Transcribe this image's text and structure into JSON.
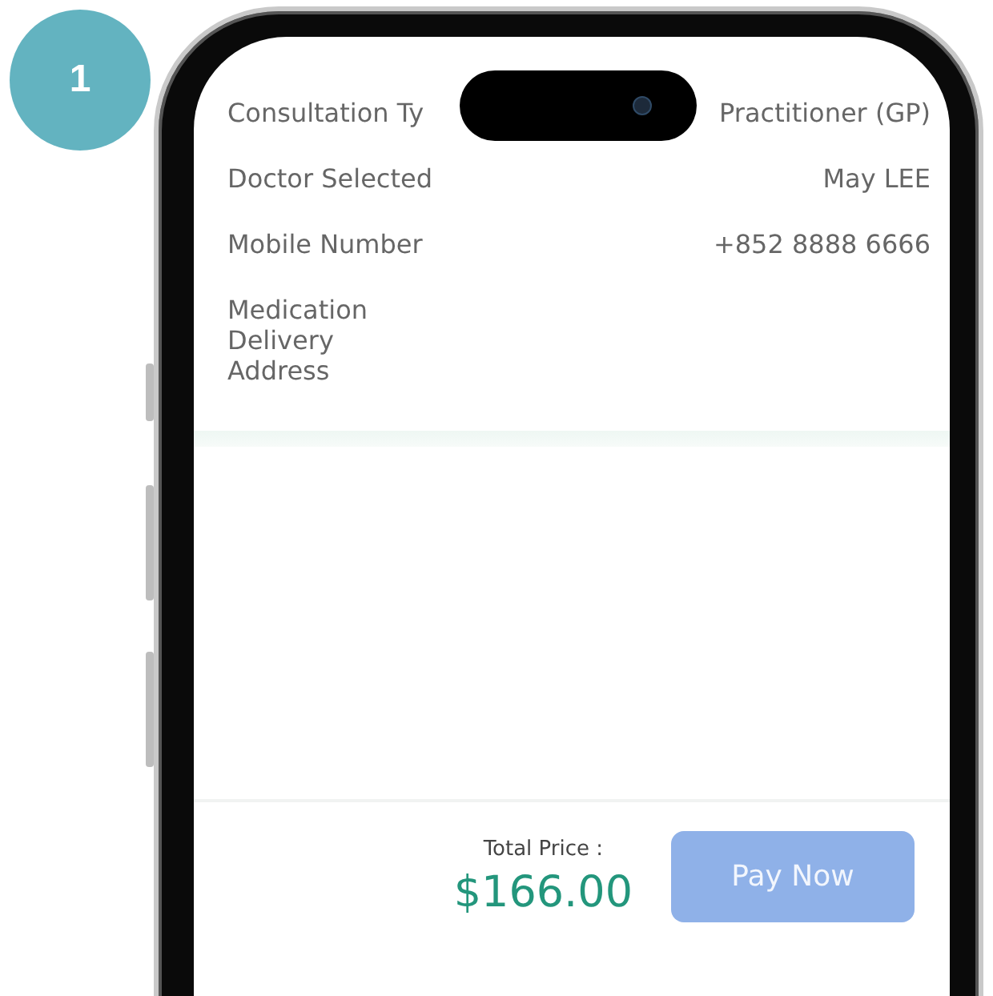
{
  "step_badge": "1",
  "details": [
    {
      "label": "Consultation Ty",
      "value": "Practitioner (GP)"
    },
    {
      "label": "Doctor Selected",
      "value": "May LEE"
    },
    {
      "label": "Mobile Number",
      "value": "+852 8888 6666"
    },
    {
      "label": "Medication\nDelivery\nAddress"
    }
  ],
  "footer": {
    "total_label": "Total Price :",
    "total": "$166.00",
    "pay_button": {
      "label": "Pay Now",
      "disabled": true
    }
  }
}
